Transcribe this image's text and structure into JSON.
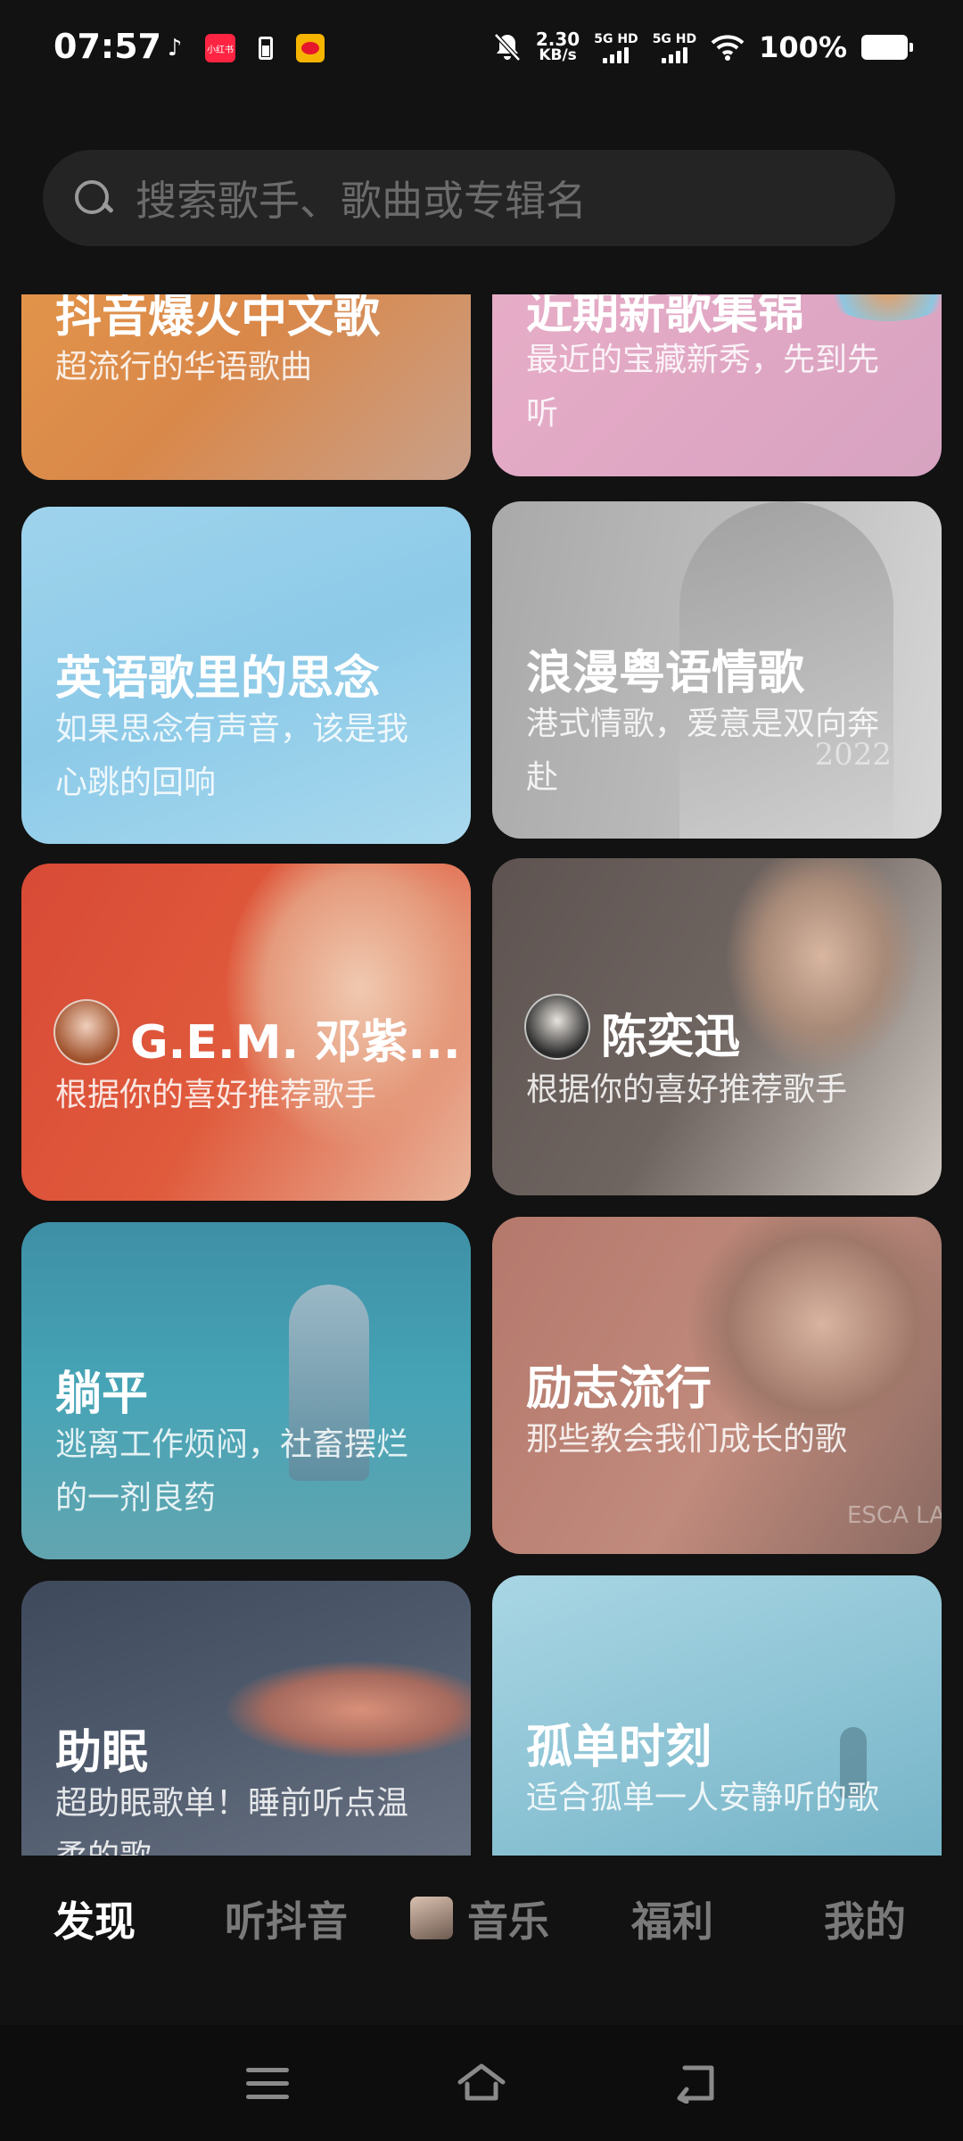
{
  "status": {
    "time": "07:57",
    "speed_top": "2.30",
    "speed_bottom": "KB/s",
    "net1": "5G HD",
    "net2": "5G HD",
    "battery": "100%",
    "icon_xhs": "小红书"
  },
  "search": {
    "placeholder": "搜索歌手、歌曲或专辑名"
  },
  "cards": [
    {
      "title": "抖音爆火中文歌",
      "subtitle": "超流行的华语歌曲"
    },
    {
      "title": "近期新歌集锦",
      "subtitle": "最近的宝藏新秀，先到先听"
    },
    {
      "title": "英语歌里的思念",
      "subtitle": "如果思念有声音，该是我心跳的回响"
    },
    {
      "title": "浪漫粤语情歌",
      "subtitle": "港式情歌，爱意是双向奔赴",
      "watermark": "2022"
    },
    {
      "title": "G.E.M. 邓紫...",
      "subtitle": "根据你的喜好推荐歌手"
    },
    {
      "title": "陈奕迅",
      "subtitle": "根据你的喜好推荐歌手"
    },
    {
      "title": "躺平",
      "subtitle": "逃离工作烦闷，社畜摆烂的一剂良药"
    },
    {
      "title": "励志流行",
      "subtitle": "那些教会我们成长的歌",
      "watermark": "ESCA LAI"
    },
    {
      "title": "助眠",
      "subtitle": "超助眠歌单！睡前听点温柔的歌"
    },
    {
      "title": "孤单时刻",
      "subtitle": "适合孤单一人安静听的歌"
    }
  ],
  "nav": {
    "items": [
      "发现",
      "听抖音",
      "音乐",
      "福利",
      "我的"
    ],
    "active": "发现"
  },
  "colors": {
    "background": "#121212",
    "search_bg": "#242424",
    "nav_inactive": "#7a7a7a"
  }
}
